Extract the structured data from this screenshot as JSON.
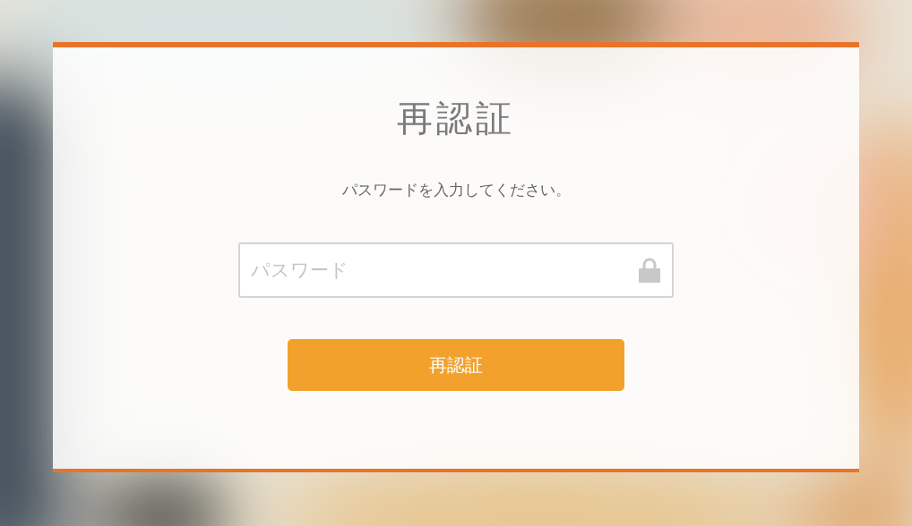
{
  "dialog": {
    "title": "再認証",
    "message": "パスワードを入力してください。",
    "password_field": {
      "placeholder": "パスワード"
    },
    "submit_button": "再認証"
  }
}
